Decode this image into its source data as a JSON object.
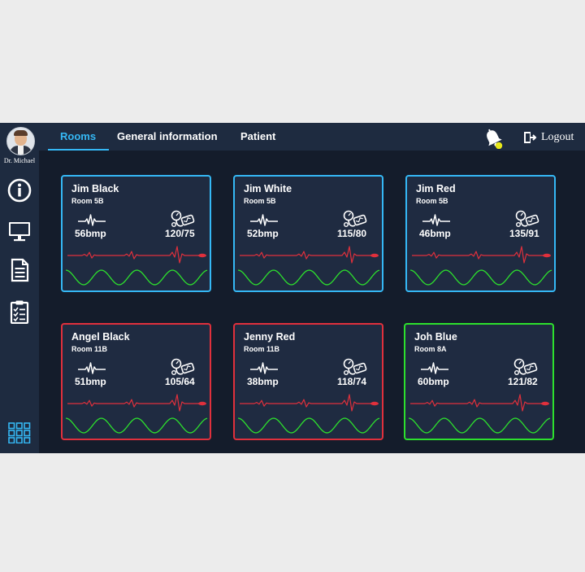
{
  "user": {
    "name": "Dr. Michael"
  },
  "nav": {
    "tabs": [
      {
        "label": "Rooms",
        "active": true
      },
      {
        "label": "General information",
        "active": false
      },
      {
        "label": "Patient",
        "active": false
      }
    ],
    "logout_label": "Logout"
  },
  "sidebar": {
    "icons": [
      "info-icon",
      "monitor-icon",
      "document-icon",
      "clipboard-icon",
      "grid-icon"
    ]
  },
  "colors": {
    "accent": "#35b8f5",
    "critical": "#e0303c",
    "normal": "#2de02d",
    "notification": "#e8e81a"
  },
  "patients": [
    {
      "name": "Jim Black",
      "room": "Room 5B",
      "bpm": "56bmp",
      "bp": "120/75",
      "status": "blue"
    },
    {
      "name": "Jim White",
      "room": "Room 5B",
      "bpm": "52bmp",
      "bp": "115/80",
      "status": "blue"
    },
    {
      "name": "Jim Red",
      "room": "Room 5B",
      "bpm": "46bmp",
      "bp": "135/91",
      "status": "blue"
    },
    {
      "name": "Angel Black",
      "room": "Room 11B",
      "bpm": "51bmp",
      "bp": "105/64",
      "status": "red"
    },
    {
      "name": "Jenny Red",
      "room": "Room 11B",
      "bpm": "38bmp",
      "bp": "118/74",
      "status": "red"
    },
    {
      "name": "Joh Blue",
      "room": "Room 8A",
      "bpm": "60bmp",
      "bp": "121/82",
      "status": "green"
    }
  ]
}
